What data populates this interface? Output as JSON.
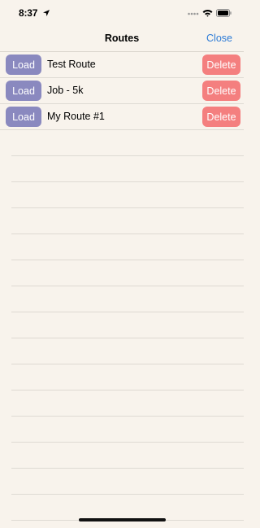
{
  "status_bar": {
    "time": "8:37",
    "icons": [
      "location-arrow-icon",
      "signal-icon",
      "wifi-icon",
      "battery-icon"
    ]
  },
  "nav": {
    "title": "Routes",
    "close_label": "Close"
  },
  "routes": [
    {
      "name": "Test Route",
      "load_label": "Load",
      "delete_label": "Delete"
    },
    {
      "name": "Job - 5k",
      "load_label": "Load",
      "delete_label": "Delete"
    },
    {
      "name": "My Route #1",
      "load_label": "Load",
      "delete_label": "Delete"
    }
  ],
  "colors": {
    "background": "#f8f3ec",
    "load_button": "#8a89bf",
    "delete_button": "#f47f7f",
    "accent": "#2d7bd6"
  }
}
